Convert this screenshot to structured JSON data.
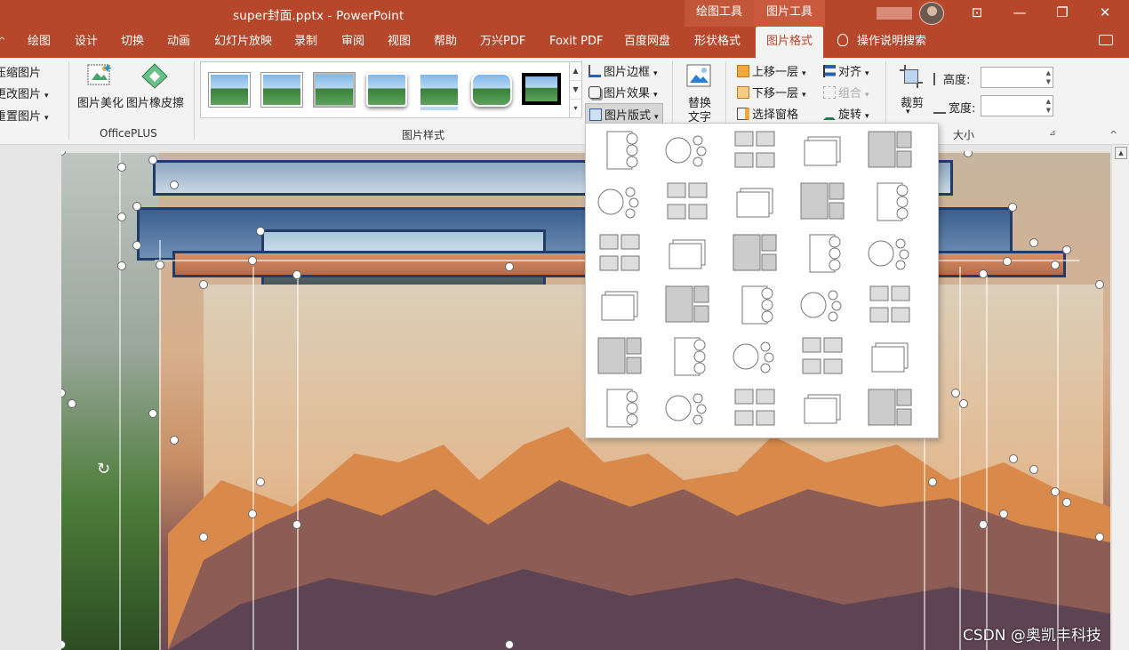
{
  "title": "super封面.pptx - PowerPoint",
  "context_groups": {
    "drawing_tools": "绘图工具",
    "picture_tools": "图片工具"
  },
  "window_controls": {
    "restore_ribbon": "⊡",
    "minimize": "—",
    "maximize": "❐",
    "close": "✕"
  },
  "tabs": [
    "绘图",
    "设计",
    "切换",
    "动画",
    "幻灯片放映",
    "录制",
    "审阅",
    "视图",
    "帮助",
    "万兴PDF",
    "Foxit PDF",
    "百度网盘",
    "形状格式",
    "图片格式",
    "操作说明搜索"
  ],
  "tab_start_arrow": "^",
  "active_tab": "图片格式",
  "ribbon": {
    "adjust": {
      "compress": "压缩图片",
      "change": "更改图片",
      "reset": "重置图片"
    },
    "officeplus": {
      "beautify": "图片美化",
      "eraser": "图片橡皮擦",
      "group_name": "OfficePLUS"
    },
    "styles": {
      "group_name": "图片样式",
      "border": "图片边框",
      "effects": "图片效果",
      "layout": "图片版式"
    },
    "accessibility": {
      "alt_text_line1": "替换",
      "alt_text_line2": "文字"
    },
    "arrange": {
      "bring_forward": "上移一层",
      "send_backward": "下移一层",
      "selection_pane": "选择窗格",
      "align": "对齐",
      "group": "组合",
      "rotate": "旋转"
    },
    "size": {
      "crop": "裁剪",
      "height_label": "高度:",
      "width_label": "宽度:",
      "group_name": "大小",
      "height_value": "",
      "width_value": ""
    }
  },
  "picture_layout_count": 30,
  "watermark": "CSDN @奥凯丰科技",
  "colors": {
    "brand": "#b7472a",
    "active_tab_text": "#b7472a"
  },
  "icons": [
    "compress-icon",
    "change-picture-icon",
    "reset-picture-icon",
    "beautify-icon",
    "eraser-icon",
    "border-icon",
    "effects-icon",
    "layout-icon",
    "alt-text-icon",
    "bring-forward-icon",
    "send-backward-icon",
    "selection-pane-icon",
    "align-icon",
    "group-icon",
    "rotate-icon",
    "crop-icon",
    "lightbulb-icon",
    "comment-icon",
    "rotate-handle-icon"
  ]
}
